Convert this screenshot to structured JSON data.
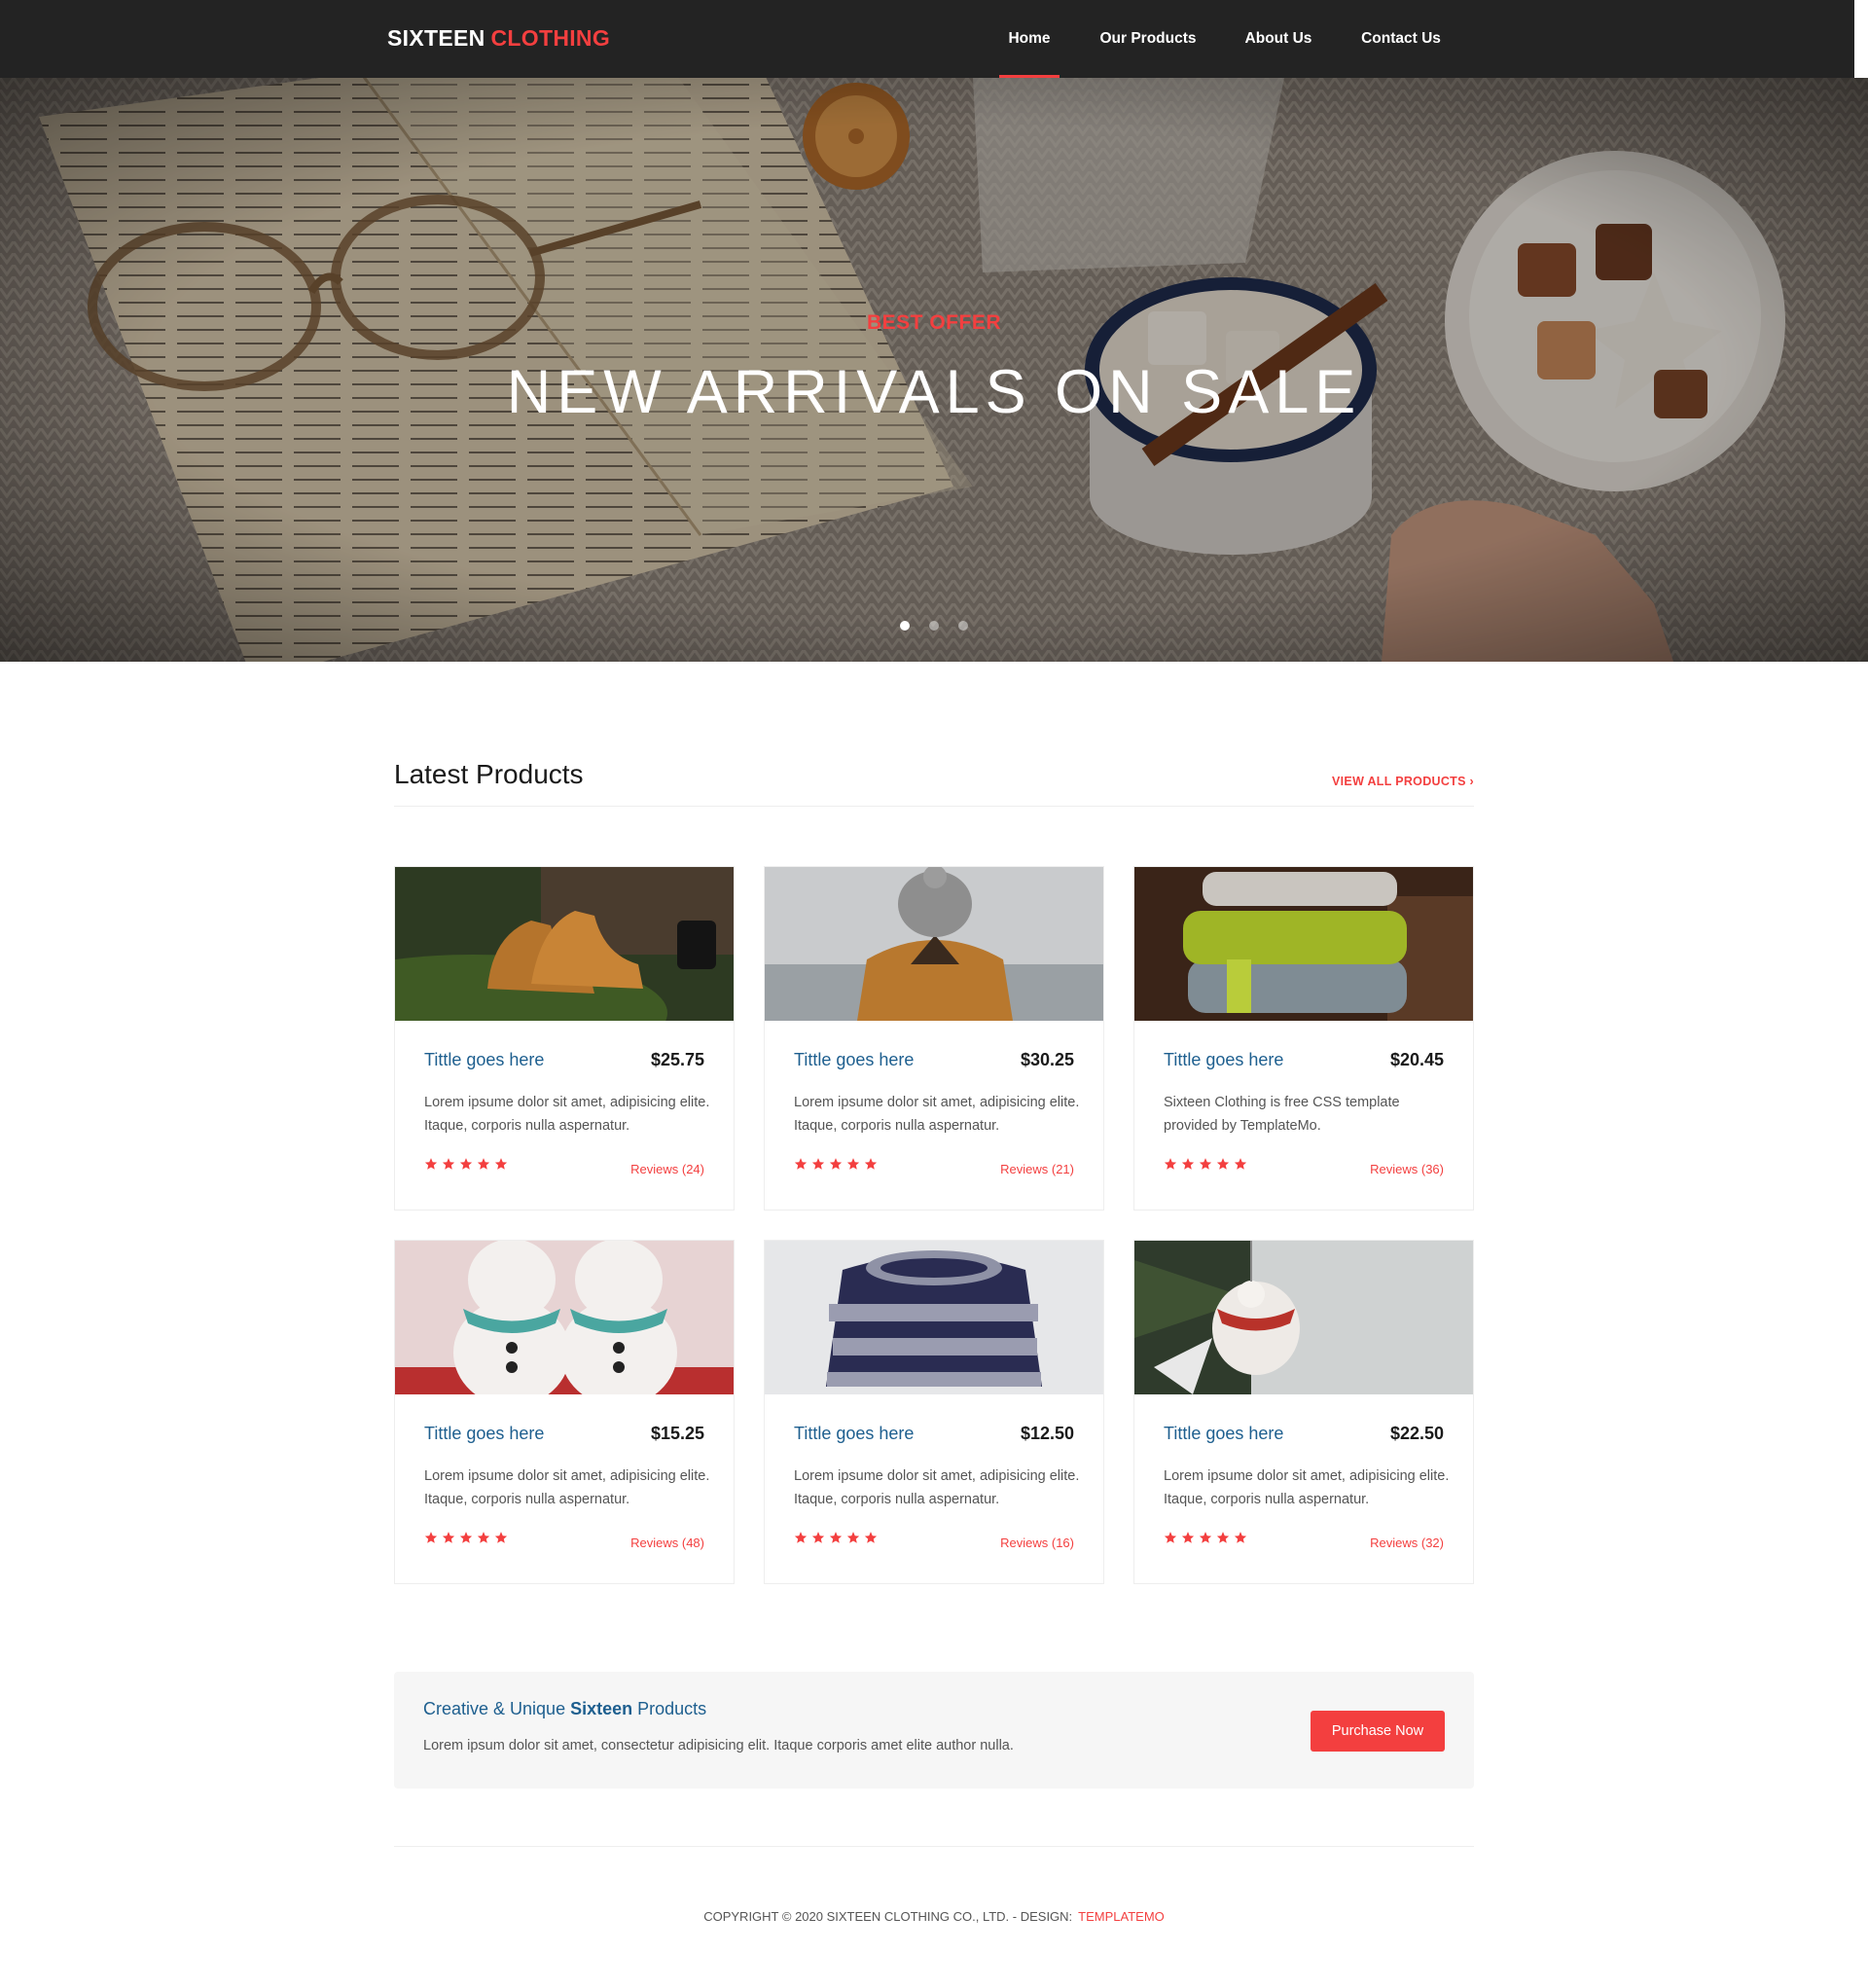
{
  "brand": {
    "part1": "SIXTEEN",
    "part2": "CLOTHING"
  },
  "nav": {
    "items": [
      {
        "label": "Home",
        "active": true
      },
      {
        "label": "Our Products"
      },
      {
        "label": "About Us"
      },
      {
        "label": "Contact Us"
      }
    ]
  },
  "hero": {
    "eyebrow": "BEST OFFER",
    "title": "NEW ARRIVALS ON SALE",
    "slides": 3,
    "current_slide": 1
  },
  "latest": {
    "title": "Latest Products",
    "view_all": "VIEW ALL PRODUCTS ›"
  },
  "products": [
    {
      "title": "Tittle goes here",
      "price": "$25.75",
      "desc": "Lorem ipsume dolor sit amet, adipisicing elite. Itaque, corporis nulla aspernatur.",
      "rating": 5,
      "reviews": "Reviews (24)",
      "image": "boots"
    },
    {
      "title": "Tittle goes here",
      "price": "$30.25",
      "desc": "Lorem ipsume dolor sit amet, adipisicing elite. Itaque, corporis nulla aspernatur.",
      "rating": 5,
      "reviews": "Reviews (21)",
      "image": "hooded-person"
    },
    {
      "title": "Tittle goes here",
      "price": "$20.45",
      "desc": "Sixteen Clothing is free CSS template provided by TemplateMo.",
      "rating": 5,
      "reviews": "Reviews (36)",
      "image": "folded-knits"
    },
    {
      "title": "Tittle goes here",
      "price": "$15.25",
      "desc": "Lorem ipsume dolor sit amet, adipisicing elite. Itaque, corporis nulla aspernatur.",
      "rating": 5,
      "reviews": "Reviews (48)",
      "image": "snowmen"
    },
    {
      "title": "Tittle goes here",
      "price": "$12.50",
      "desc": "Lorem ipsume dolor sit amet, adipisicing elite. Itaque, corporis nulla aspernatur.",
      "rating": 5,
      "reviews": "Reviews (16)",
      "image": "striped-sweater"
    },
    {
      "title": "Tittle goes here",
      "price": "$22.50",
      "desc": "Lorem ipsume dolor sit amet, adipisicing elite. Itaque, corporis nulla aspernatur.",
      "rating": 5,
      "reviews": "Reviews (32)",
      "image": "bird-ornament"
    }
  ],
  "cta": {
    "title_pre": "Creative & Unique",
    "title_bold": "Sixteen",
    "title_post": "Products",
    "text": "Lorem ipsum dolor sit amet, consectetur adipisicing elit. Itaque corporis amet elite author nulla.",
    "button": "Purchase Now"
  },
  "footer": {
    "text": "COPYRIGHT © 2020 SIXTEEN CLOTHING CO., LTD. - DESIGN:",
    "link": "TEMPLATEMO"
  },
  "colors": {
    "accent": "#f33f3f",
    "nav_bg": "#232323",
    "title_blue": "#1e5f8f"
  }
}
